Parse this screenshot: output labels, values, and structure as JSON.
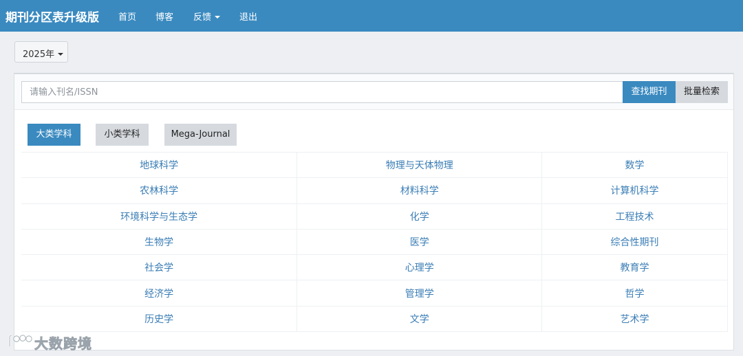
{
  "navbar": {
    "brand": "期刊分区表升级版",
    "links": [
      "首页",
      "博客",
      "反馈",
      "退出"
    ]
  },
  "year_dropdown": {
    "selected": "2025年"
  },
  "search": {
    "placeholder": "请输入刊名/ISSN",
    "value": "",
    "find_label": "查找期刊",
    "batch_label": "批量检索"
  },
  "tabs": [
    {
      "label": "大类学科",
      "active": true
    },
    {
      "label": "小类学科",
      "active": false
    },
    {
      "label": "Mega-Journal",
      "active": false
    }
  ],
  "subjects": [
    [
      "地球科学",
      "物理与天体物理",
      "数学"
    ],
    [
      "农林科学",
      "材料科学",
      "计算机科学"
    ],
    [
      "环境科学与生态学",
      "化学",
      "工程技术"
    ],
    [
      "生物学",
      "医学",
      "综合性期刊"
    ],
    [
      "社会学",
      "心理学",
      "教育学"
    ],
    [
      "经济学",
      "管理学",
      "哲学"
    ],
    [
      "历史学",
      "文学",
      "艺术学"
    ]
  ],
  "watermark": {
    "text": "大数跨境"
  },
  "colors": {
    "navbar": "#3a8ac0",
    "primary_button": "#3a8ac0",
    "secondary_button": "#d6dadf",
    "link": "#3a7db5",
    "page_background": "#edeff2"
  }
}
